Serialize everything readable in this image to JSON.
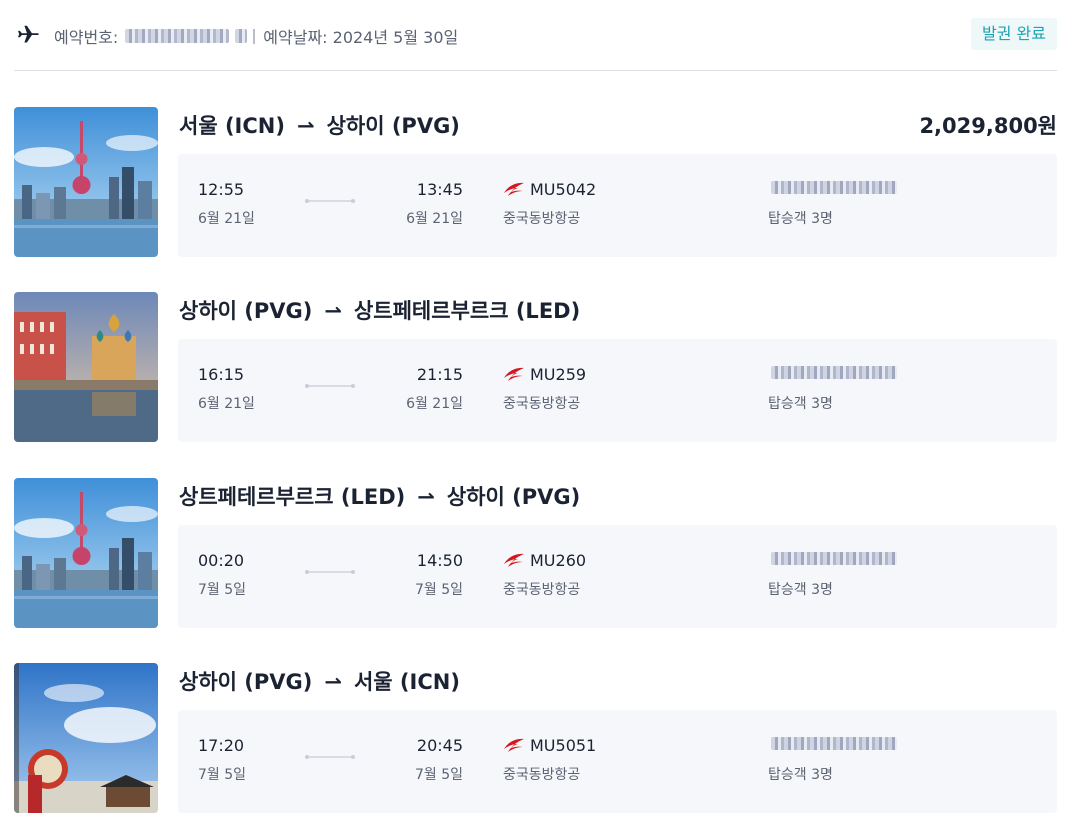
{
  "header": {
    "booking_label": "예약번호:",
    "booking_date_label": "예약날짜: 2024년 5월 30일",
    "status": "발권 완료"
  },
  "price": "2,029,800원",
  "segments": [
    {
      "from": "서울 (ICN)",
      "to": "상하이 (PVG)",
      "image": "shanghai-skyline",
      "dep_time": "12:55",
      "dep_date": "6월 21일",
      "arr_time": "13:45",
      "arr_date": "6월 21일",
      "flight_no": "MU5042",
      "airline": "중국동방항공",
      "passengers": "탑승객 3명"
    },
    {
      "from": "상하이 (PVG)",
      "to": "상트페테르부르크 (LED)",
      "image": "saint-petersburg-church",
      "dep_time": "16:15",
      "dep_date": "6월 21일",
      "arr_time": "21:15",
      "arr_date": "6월 21일",
      "flight_no": "MU259",
      "airline": "중국동방항공",
      "passengers": "탑승객 3명"
    },
    {
      "from": "상트페테르부르크 (LED)",
      "to": "상하이 (PVG)",
      "image": "shanghai-skyline",
      "dep_time": "00:20",
      "dep_date": "7월 5일",
      "arr_time": "14:50",
      "arr_date": "7월 5일",
      "flight_no": "MU260",
      "airline": "중국동방항공",
      "passengers": "탑승객 3명"
    },
    {
      "from": "상하이 (PVG)",
      "to": "서울 (ICN)",
      "image": "seoul-palace-drum",
      "dep_time": "17:20",
      "dep_date": "7월 5일",
      "arr_time": "20:45",
      "arr_date": "7월 5일",
      "flight_no": "MU5051",
      "airline": "중국동방항공",
      "passengers": "탑승객 3명"
    }
  ],
  "icons": {
    "header": "airplane-icon",
    "airline": "china-eastern-logo-icon",
    "route_arrow": "right-arrow-icon"
  },
  "colors": {
    "accent": "#1da3b3",
    "badge_bg": "#eef8f9",
    "card_bg": "#f6f7fa",
    "airline_red": "#d5171f"
  }
}
